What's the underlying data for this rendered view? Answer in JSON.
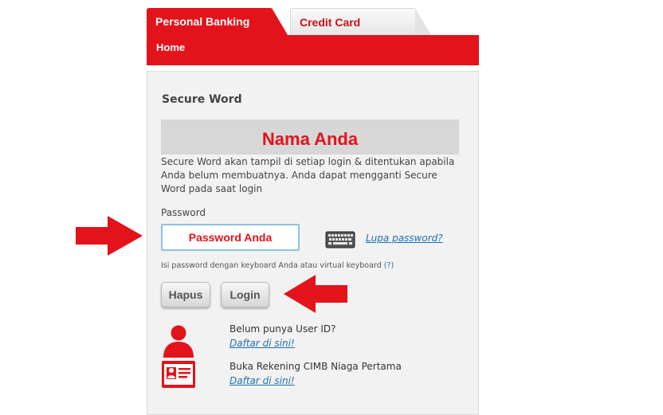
{
  "tabs": [
    {
      "label": "Personal Banking",
      "active": true
    },
    {
      "label": "Credit Card",
      "active": false
    }
  ],
  "nav": {
    "home": "Home"
  },
  "secure_word": {
    "title": "Secure Word",
    "value": "Nama Anda",
    "description": "Secure Word akan tampil di setiap login & ditentukan apabila Anda belum membuatnya. Anda dapat mengganti Secure Word pada saat login"
  },
  "password": {
    "label": "Password",
    "value": "Password Anda",
    "forgot_link": "Lupa password?",
    "keyboard_hint": "Isi password dengan keyboard Anda atau virtual keyboard",
    "hint_help": "(?)"
  },
  "buttons": {
    "clear": "Hapus",
    "login": "Login"
  },
  "register": {
    "text": "Belum punya User ID?",
    "link": "Daftar di sini!"
  },
  "open_account": {
    "text": "Buka Rekening CIMB Niaga Pertama",
    "link": "Daftar di sini!"
  },
  "icons": {
    "keyboard": "virtual-keyboard-icon",
    "user": "user-icon",
    "card": "id-card-icon",
    "arrows": "red-arrow-icon"
  },
  "colors": {
    "brand_red": "#e3131b",
    "link_blue": "#1f6fb2",
    "panel_bg": "#f2f2f2"
  }
}
